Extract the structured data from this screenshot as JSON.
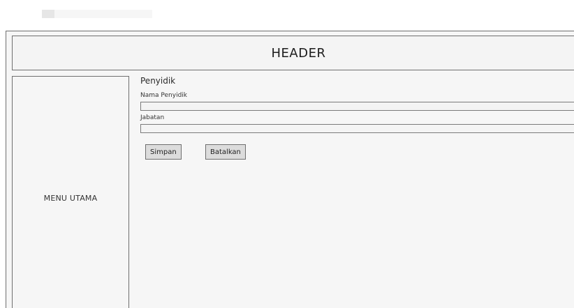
{
  "header": {
    "title": "HEADER"
  },
  "sidebar": {
    "label": "MENU UTAMA"
  },
  "form": {
    "title": "Penyidik",
    "fields": [
      {
        "label": "Nama Penyidik",
        "value": "",
        "placeholder": ""
      },
      {
        "label": "Jabatan",
        "value": "",
        "placeholder": ""
      }
    ],
    "buttons": {
      "save": "Simpan",
      "cancel": "Batalkan"
    }
  }
}
